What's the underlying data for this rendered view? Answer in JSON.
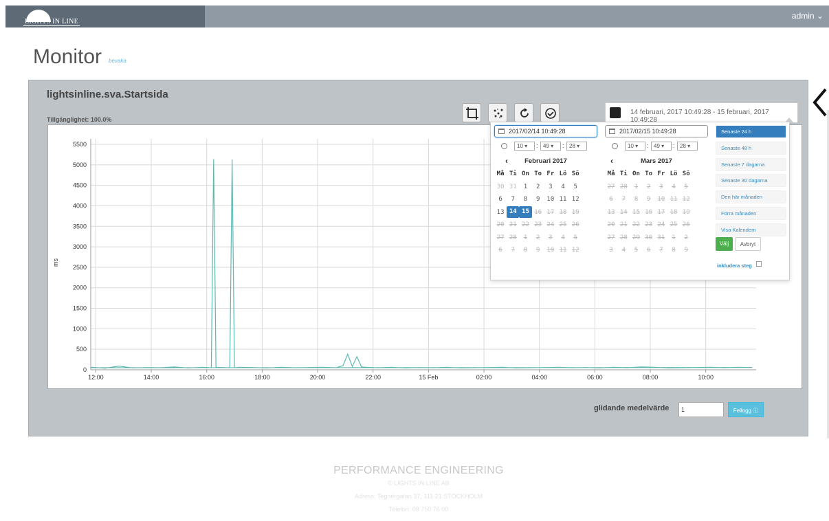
{
  "header": {
    "logo_text": "LIGHTS IN LINE",
    "user_menu": "admin"
  },
  "page": {
    "title": "Monitor",
    "subtitle": "bevaka"
  },
  "panel": {
    "title": "lightsinline.sva.Startsida",
    "availability": "Tillgänglighet: 100.0%",
    "toolbar": [
      "crop-icon",
      "scatter-icon",
      "refresh-icon",
      "reset-icon"
    ],
    "date_range": "14 februari, 2017 10:49:28 - 15 februari, 2017 10:49:28"
  },
  "chart_data": {
    "type": "line",
    "ylabel": "ms",
    "xlabel": "",
    "ylim": [
      0,
      5500
    ],
    "yticks": [
      0,
      500,
      1000,
      1500,
      2000,
      2500,
      3000,
      3500,
      4000,
      4500,
      5000,
      5500
    ],
    "xtick_labels": [
      "12:00",
      "14:00",
      "16:00",
      "18:00",
      "20:00",
      "22:00",
      "15 Feb",
      "02:00",
      "04:00",
      "06:00",
      "08:00",
      "10:00"
    ],
    "x_start": "2017-02-14 10:49",
    "x_end": "2017-02-15 10:49",
    "grid": true,
    "color": "#5fb8b0",
    "series": [
      {
        "x": [
          "10:50",
          "11:20",
          "11:50",
          "12:20",
          "12:50",
          "13:20",
          "13:50",
          "14:20",
          "14:50",
          "15:10",
          "15:15",
          "15:20",
          "15:35",
          "15:50",
          "15:55",
          "16:00",
          "16:10",
          "16:40",
          "17:10",
          "17:40",
          "18:10",
          "18:40",
          "19:10",
          "19:40",
          "19:55",
          "20:05",
          "20:15",
          "20:25",
          "20:35",
          "20:45",
          "21:10",
          "21:40",
          "22:10",
          "22:40",
          "23:10",
          "23:40",
          "00:10",
          "00:40",
          "01:10",
          "01:40",
          "02:10",
          "02:40",
          "03:10",
          "03:40",
          "04:10",
          "04:40",
          "05:10",
          "05:40",
          "06:10",
          "06:40",
          "07:10",
          "07:40",
          "08:10",
          "08:40",
          "09:10",
          "09:40",
          "10:10",
          "10:40",
          "10:49"
        ],
        "y": [
          60,
          40,
          90,
          45,
          55,
          50,
          70,
          45,
          60,
          50,
          5130,
          60,
          55,
          50,
          5120,
          50,
          60,
          55,
          45,
          60,
          50,
          55,
          60,
          50,
          100,
          380,
          80,
          320,
          70,
          60,
          50,
          60,
          45,
          55,
          50,
          60,
          45,
          50,
          55,
          60,
          45,
          50,
          55,
          60,
          50,
          55,
          45,
          60,
          50,
          70,
          60,
          45,
          50,
          55,
          60,
          50,
          60,
          55,
          50
        ]
      }
    ]
  },
  "smoothing": {
    "label": "glidande medelvärde",
    "value": "1",
    "button": "Fellogg"
  },
  "picker": {
    "start_input": "2017/02/14 10:49:28",
    "end_input": "2017/02/15 10:49:28",
    "start_time": {
      "hour": "10",
      "minute": "49",
      "second": "28"
    },
    "end_time": {
      "hour": "10",
      "minute": "49",
      "second": "28"
    },
    "left_month": "Februari 2017",
    "right_month": "Mars 2017",
    "weekdays": [
      "Må",
      "Ti",
      "On",
      "To",
      "Fr",
      "Lö",
      "Sö"
    ],
    "left_days": [
      [
        "30",
        "31",
        "1",
        "2",
        "3",
        "4",
        "5"
      ],
      [
        "6",
        "7",
        "8",
        "9",
        "10",
        "11",
        "12"
      ],
      [
        "13",
        "14",
        "15",
        "16",
        "17",
        "18",
        "19"
      ],
      [
        "20",
        "21",
        "22",
        "23",
        "24",
        "25",
        "26"
      ],
      [
        "27",
        "28",
        "1",
        "2",
        "3",
        "4",
        "5"
      ],
      [
        "6",
        "7",
        "8",
        "9",
        "10",
        "11",
        "12"
      ]
    ],
    "right_days": [
      [
        "27",
        "28",
        "1",
        "2",
        "3",
        "4",
        "5"
      ],
      [
        "6",
        "7",
        "8",
        "9",
        "10",
        "11",
        "12"
      ],
      [
        "13",
        "14",
        "15",
        "16",
        "17",
        "18",
        "19"
      ],
      [
        "20",
        "21",
        "22",
        "23",
        "24",
        "25",
        "26"
      ],
      [
        "27",
        "28",
        "29",
        "30",
        "31",
        "1",
        "2"
      ],
      [
        "3",
        "4",
        "5",
        "6",
        "7",
        "8",
        "9"
      ]
    ],
    "ranges": [
      "Senaste 24 h",
      "Senaste 48 h",
      "Senaste 7 dagarna",
      "Senaste 30 dagarna",
      "Den här månaden",
      "Förra månaden",
      "Visa Kalendern"
    ],
    "apply": "Välj",
    "cancel": "Avbryt",
    "include_steps": "inkludera steg"
  },
  "footer": {
    "title": "PERFORMANCE ENGINEERING",
    "company": "© LIGHTS IN LINE AB",
    "address": "Adress: Tegnérgatan 37, 111 21 STOCKHOLM",
    "phone": "Telefon: 08 750 76 00"
  }
}
